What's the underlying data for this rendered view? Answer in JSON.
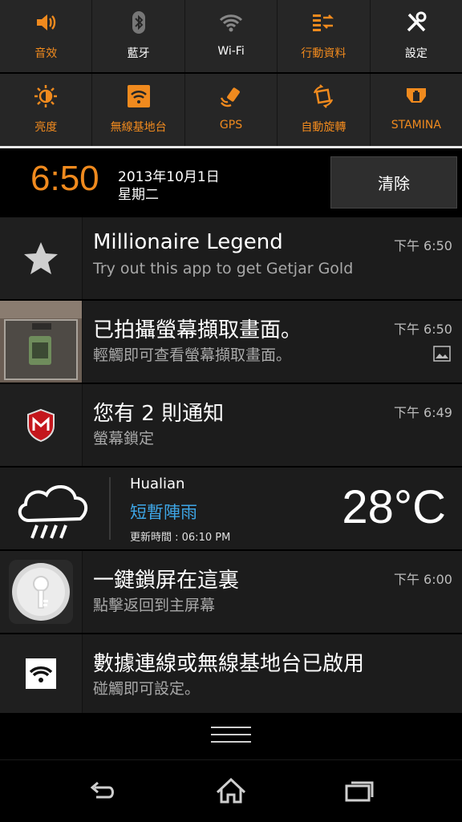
{
  "quick_settings": {
    "row1": [
      {
        "label": "音效",
        "icon": "speaker-icon",
        "state": "on"
      },
      {
        "label": "藍牙",
        "icon": "bluetooth-icon",
        "state": "off"
      },
      {
        "label": "Wi-Fi",
        "icon": "wifi-icon",
        "state": "off"
      },
      {
        "label": "行動資料",
        "icon": "mobile-data-icon",
        "state": "on"
      },
      {
        "label": "設定",
        "icon": "settings-tools-icon",
        "state": "off"
      }
    ],
    "row2": [
      {
        "label": "亮度",
        "icon": "brightness-icon",
        "state": "on"
      },
      {
        "label": "無線基地台",
        "icon": "hotspot-icon",
        "state": "on"
      },
      {
        "label": "GPS",
        "icon": "gps-icon",
        "state": "on"
      },
      {
        "label": "自動旋轉",
        "icon": "auto-rotate-icon",
        "state": "on"
      },
      {
        "label": "STAMINA",
        "icon": "stamina-icon",
        "state": "on"
      }
    ]
  },
  "clock": {
    "time": "6:50",
    "date": "2013年10月1日",
    "weekday": "星期二"
  },
  "clear_label": "清除",
  "notifications": [
    {
      "title": "Millionaire Legend",
      "subtitle": "Try out this app to get Getjar Gold",
      "time": "下午 6:50",
      "icon": "star-icon"
    },
    {
      "title": "已拍攝螢幕擷取畫面。",
      "subtitle": "輕觸即可查看螢幕擷取畫面。",
      "time": "下午 6:50",
      "icon": "screenshot-thumbnail"
    },
    {
      "title": "您有 2 則通知",
      "subtitle": "螢幕鎖定",
      "time": "下午 6:49",
      "icon": "mcafee-icon"
    }
  ],
  "weather": {
    "city": "Hualian",
    "condition": "短暫陣雨",
    "updated": "更新時間 : 06:10 PM",
    "temperature": "28°C",
    "icon": "rain-cloud-icon"
  },
  "notifications2": [
    {
      "title": "一鍵鎖屏在這裏",
      "subtitle": "點擊返回到主屏幕",
      "time": "下午 6:00",
      "icon": "key-lock-icon"
    },
    {
      "title": "數據連線或無線基地台已啟用",
      "subtitle": "碰觸即可設定。",
      "time": "",
      "icon": "wifi-hotspot-icon"
    }
  ],
  "colors": {
    "accent": "#f08a1e",
    "weather_blue": "#3ea6e6",
    "panel": "#1c1c1c"
  }
}
